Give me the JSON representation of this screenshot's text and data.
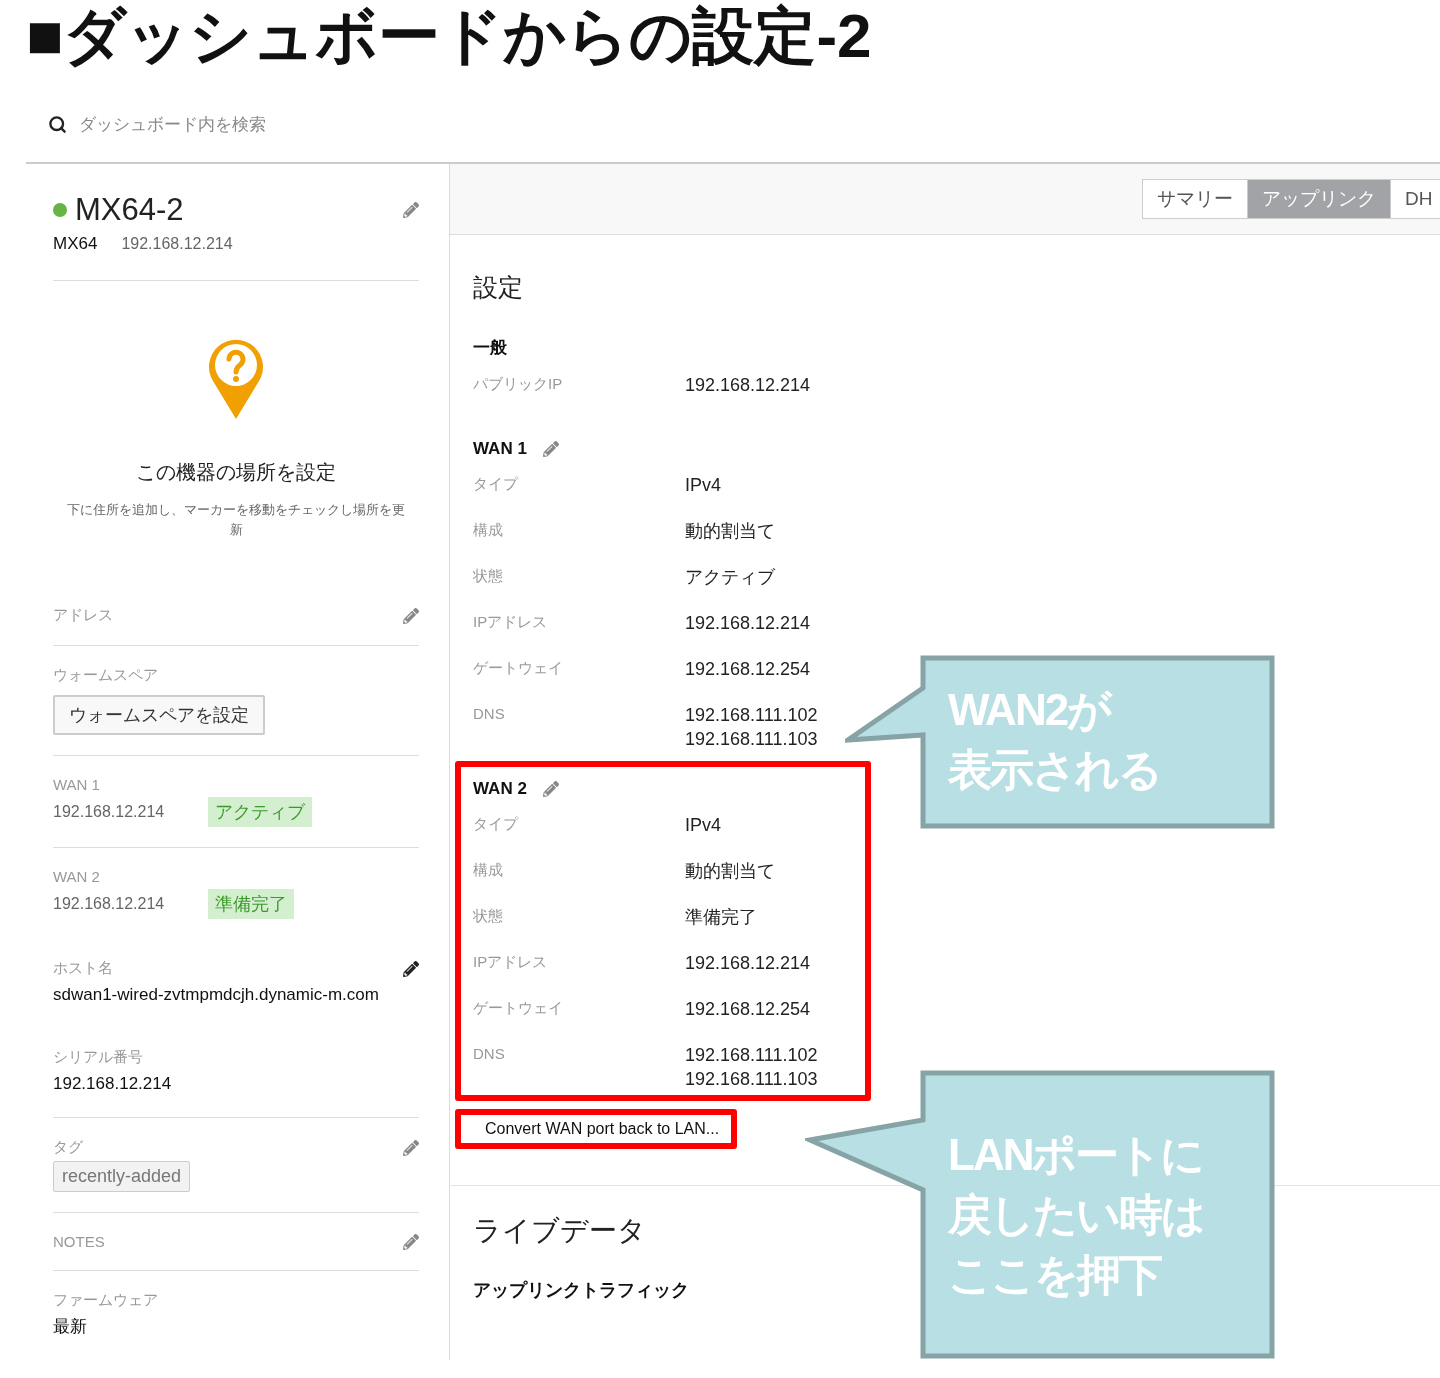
{
  "title": "■ダッシュボードからの設定-2",
  "search": {
    "placeholder": "ダッシュボード内を検索"
  },
  "device": {
    "name": "MX64-2",
    "online": true,
    "model": "MX64",
    "ip": "192.168.12.214"
  },
  "location": {
    "title": "この機器の場所を設定",
    "description": "下に住所を追加し、マーカーを移動をチェックし場所を更新"
  },
  "sidebar": [
    {
      "kind": "label",
      "label": "アドレス",
      "editable": true
    },
    {
      "kind": "button",
      "label": "ウォームスペア",
      "button": "ウォームスペアを設定"
    },
    {
      "kind": "uplink",
      "label": "WAN 1",
      "ip": "192.168.12.214",
      "badge": "アクティブ"
    },
    {
      "kind": "uplink",
      "label": "WAN 2",
      "ip": "192.168.12.214",
      "badge": "準備完了"
    },
    {
      "kind": "value",
      "label": "ホスト名",
      "editable": true,
      "value": "sdwan1-wired-zvtmpmdcjh.dynamic-m.com"
    },
    {
      "kind": "value",
      "label": "シリアル番号",
      "editable": false,
      "value": "192.168.12.214"
    },
    {
      "kind": "tag",
      "label": "タグ",
      "editable": true,
      "tag": "recently-added"
    },
    {
      "kind": "label",
      "label": "NOTES",
      "editable": true
    },
    {
      "kind": "value",
      "label": "ファームウェア",
      "editable": false,
      "value": "最新"
    }
  ],
  "tabs": [
    {
      "label": "サマリー",
      "selected": false
    },
    {
      "label": "アップリンク",
      "selected": true
    },
    {
      "label": "DH",
      "selected": false
    }
  ],
  "settings": {
    "heading": "設定",
    "general": {
      "heading": "一般",
      "rows": [
        {
          "label": "パブリックIP",
          "values": [
            "192.168.12.214"
          ]
        }
      ]
    },
    "wans": [
      {
        "heading": "WAN 1",
        "highlighted": false,
        "rows": [
          {
            "label": "タイプ",
            "values": [
              "IPv4"
            ]
          },
          {
            "label": "構成",
            "values": [
              "動的割当て"
            ]
          },
          {
            "label": "状態",
            "values": [
              "アクティブ"
            ]
          },
          {
            "label": "IPアドレス",
            "values": [
              "192.168.12.214"
            ]
          },
          {
            "label": "ゲートウェイ",
            "values": [
              "192.168.12.254"
            ]
          },
          {
            "label": "DNS",
            "values": [
              "192.168.111.102",
              "192.168.111.103"
            ]
          }
        ]
      },
      {
        "heading": "WAN 2",
        "highlighted": true,
        "rows": [
          {
            "label": "タイプ",
            "values": [
              "IPv4"
            ]
          },
          {
            "label": "構成",
            "values": [
              "動的割当て"
            ]
          },
          {
            "label": "状態",
            "values": [
              "準備完了"
            ]
          },
          {
            "label": "IPアドレス",
            "values": [
              "192.168.12.214"
            ]
          },
          {
            "label": "ゲートウェイ",
            "values": [
              "192.168.12.254"
            ]
          },
          {
            "label": "DNS",
            "values": [
              "192.168.111.102",
              "192.168.111.103"
            ]
          }
        ]
      }
    ],
    "convert": {
      "label": "Convert WAN port back to LAN...",
      "highlighted": true
    }
  },
  "live": {
    "heading": "ライブデータ",
    "subheading": "アップリンクトラフィック"
  },
  "callouts": [
    {
      "lines": [
        "WAN2が",
        "表示される"
      ]
    },
    {
      "lines": [
        "LANポートに",
        "戻したい時は",
        "ここを押下"
      ]
    }
  ]
}
